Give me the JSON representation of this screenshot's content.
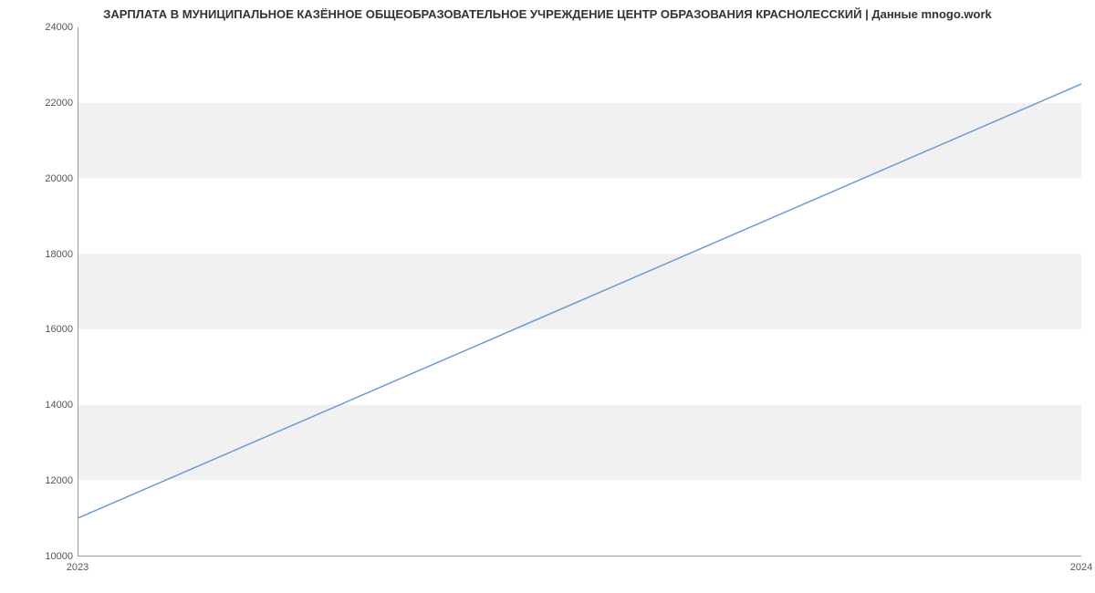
{
  "chart_data": {
    "type": "line",
    "title": "ЗАРПЛАТА В МУНИЦИПАЛЬНОЕ КАЗЁННОЕ ОБЩЕОБРАЗОВАТЕЛЬНОЕ УЧРЕЖДЕНИЕ ЦЕНТР ОБРАЗОВАНИЯ КРАСНОЛЕССКИЙ | Данные mnogo.work",
    "xlabel": "",
    "ylabel": "",
    "x_categories": [
      "2023",
      "2024"
    ],
    "x": [
      2023,
      2024
    ],
    "values": [
      11000,
      22500
    ],
    "ylim": [
      10000,
      24000
    ],
    "y_ticks": [
      10000,
      12000,
      14000,
      16000,
      18000,
      20000,
      22000,
      24000
    ],
    "x_ticks": [
      "2023",
      "2024"
    ],
    "line_color": "#6b9bd2"
  }
}
